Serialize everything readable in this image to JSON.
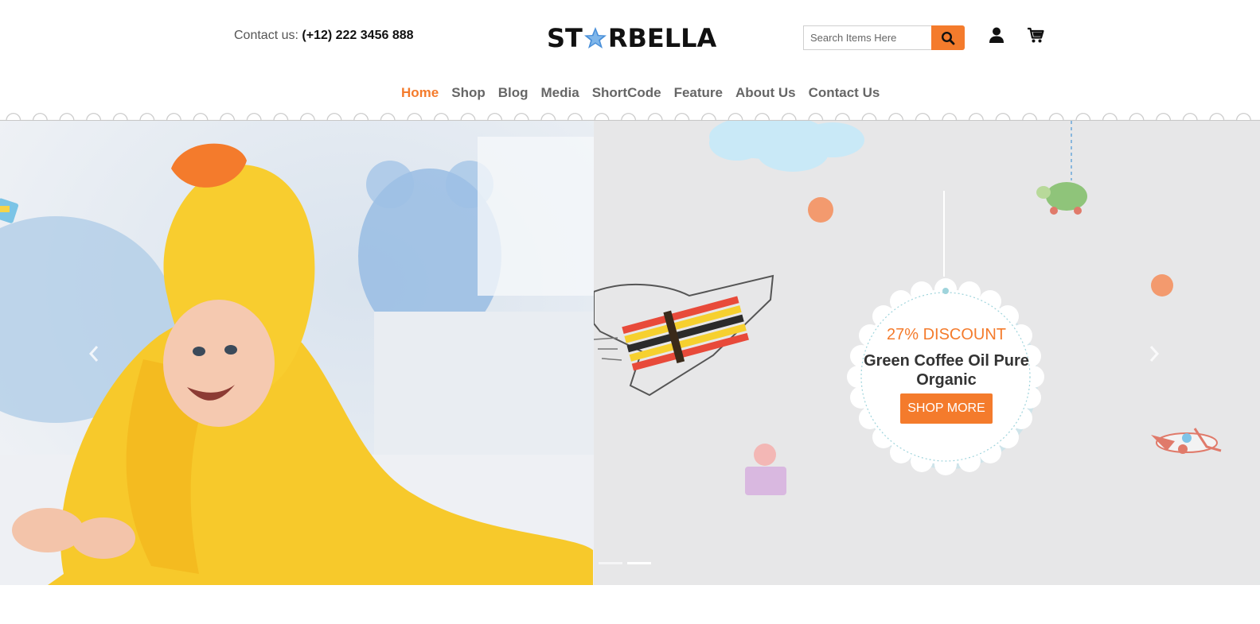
{
  "header": {
    "contact_label": "Contact us:",
    "contact_phone": "(+12) 222 3456 888",
    "logo_prefix": "ST",
    "logo_suffix": "RBELLA",
    "search_placeholder": "Search Items Here",
    "search_icon": "search-icon",
    "user_icon": "user-icon",
    "cart_icon": "cart-icon"
  },
  "nav": {
    "items": [
      {
        "label": "Home",
        "active": true
      },
      {
        "label": "Shop"
      },
      {
        "label": "Blog"
      },
      {
        "label": "Media"
      },
      {
        "label": "ShortCode"
      },
      {
        "label": "Feature"
      },
      {
        "label": "About Us"
      },
      {
        "label": "Contact Us"
      }
    ]
  },
  "hero": {
    "discount": "27% DISCOUNT",
    "title": "Green Coffee Oil Pure Organic",
    "button": "SHOP MORE",
    "slides_count": 2,
    "active_slide": 2
  },
  "colors": {
    "accent": "#f47b2c",
    "text_dark": "#333333",
    "nav_text": "#666666",
    "hero_bg": "#e7e7e8"
  }
}
